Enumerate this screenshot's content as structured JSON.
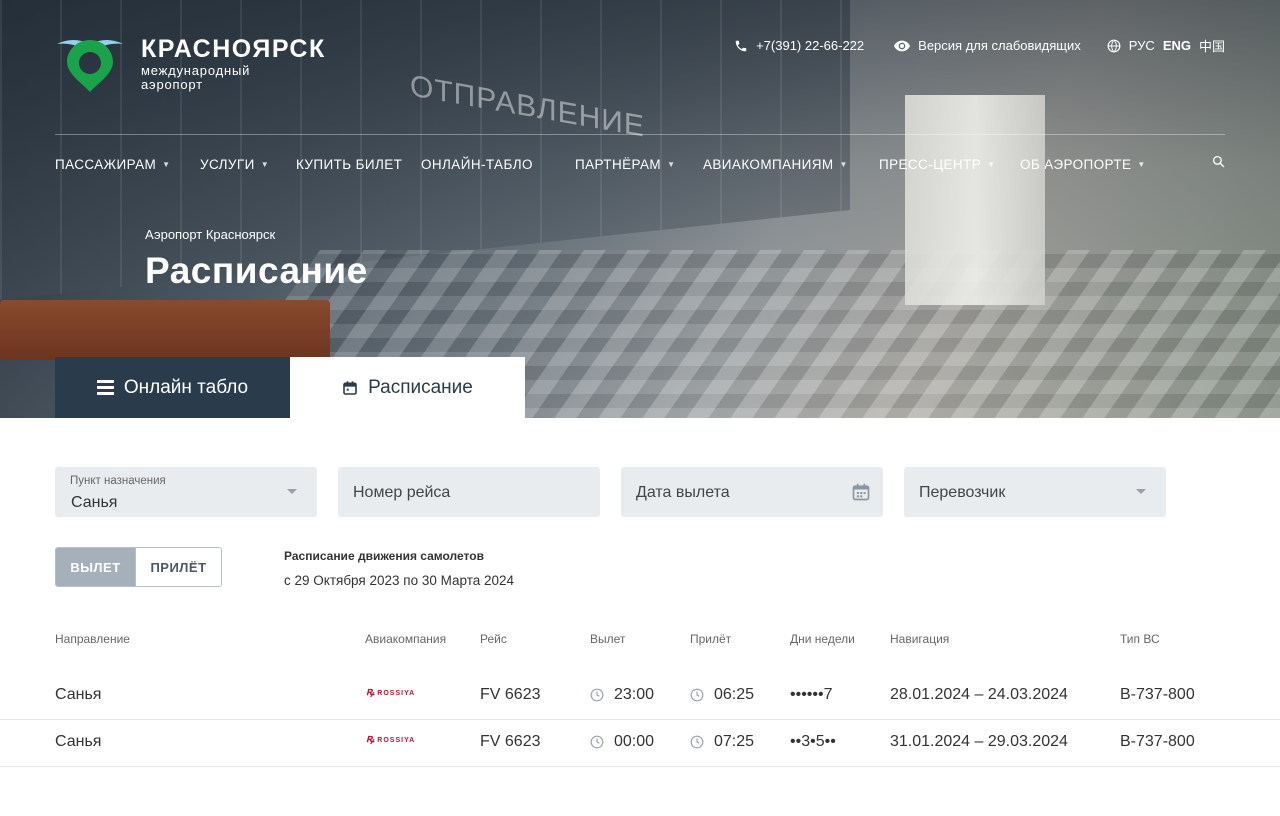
{
  "brand": {
    "title": "КРАСНОЯРСК",
    "subtitle_line1": "международный",
    "subtitle_line2": "аэропорт",
    "accent_color": "#1aa34a"
  },
  "top_bar": {
    "phone": "+7(391) 22-66-222",
    "accessibility": "Версия для слабовидящих",
    "languages": [
      "РУС",
      "ENG",
      "中国"
    ],
    "active_language": "ENG"
  },
  "nav": {
    "items": [
      {
        "label": "ПАССАЖИРАМ",
        "has_menu": true
      },
      {
        "label": "УСЛУГИ",
        "has_menu": true
      },
      {
        "label": "КУПИТЬ БИЛЕТ",
        "has_menu": false
      },
      {
        "label": "ОНЛАЙН-ТАБЛО",
        "has_menu": false
      },
      {
        "label": "ПАРТНЁРАМ",
        "has_menu": true
      },
      {
        "label": "АВИАКОМПАНИЯМ",
        "has_menu": true
      },
      {
        "label": "ПРЕСС-ЦЕНТР",
        "has_menu": true
      },
      {
        "label": "ОБ АЭРОПОРТЕ",
        "has_menu": true
      }
    ]
  },
  "hero": {
    "breadcrumb": "Аэропорт Красноярск",
    "title": "Расписание",
    "wall_sign": "ОТПРАВЛЕНИЕ"
  },
  "tabs": [
    {
      "label": "Онлайн табло",
      "icon": "list-icon",
      "active": false
    },
    {
      "label": "Расписание",
      "icon": "calendar-icon",
      "active": true
    }
  ],
  "filters": {
    "destination": {
      "label": "Пункт назначения",
      "value": "Санья"
    },
    "flight_number": {
      "placeholder": "Номер рейса"
    },
    "departure_date": {
      "placeholder": "Дата вылета"
    },
    "carrier": {
      "placeholder": "Перевозчик"
    }
  },
  "direction_toggle": {
    "departure": "ВЫЛЕТ",
    "arrival": "ПРИЛЁТ",
    "selected": "ВЫЛЕТ"
  },
  "period": {
    "title": "Расписание движения самолетов",
    "range": "с 29 Октября 2023 по 30 Марта 2024"
  },
  "table": {
    "headers": [
      "Направление",
      "Авиакомпания",
      "Рейс",
      "Вылет",
      "Прилёт",
      "Дни недели",
      "Навигация",
      "Тип ВС"
    ],
    "rows": [
      {
        "destination": "Санья",
        "airline": "ROSSIYA",
        "flight": "FV 6623",
        "departure": "23:00",
        "arrival": "06:25",
        "days": "••••••7",
        "navigation": "28.01.2024 – 24.03.2024",
        "aircraft": "B-737-800"
      },
      {
        "destination": "Санья",
        "airline": "ROSSIYA",
        "flight": "FV 6623",
        "departure": "00:00",
        "arrival": "07:25",
        "days": "••3•5••",
        "navigation": "31.01.2024 – 29.03.2024",
        "aircraft": "B-737-800"
      }
    ]
  }
}
